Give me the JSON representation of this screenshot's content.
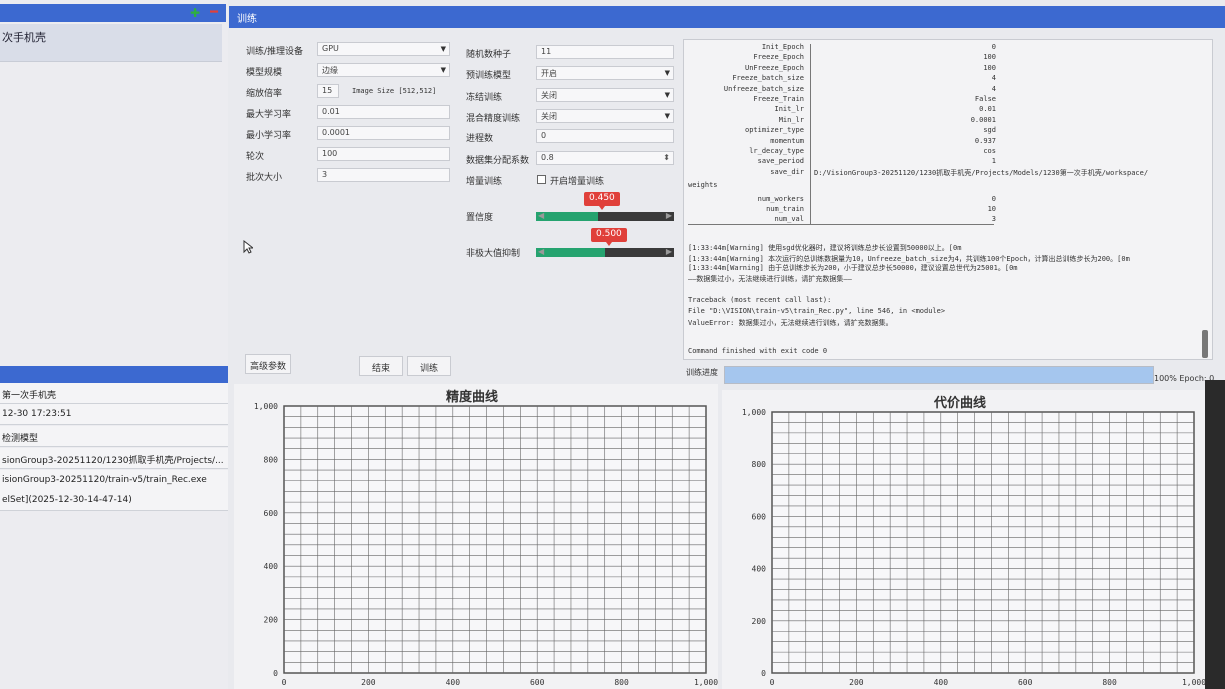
{
  "left_panel": {
    "tree_item": "次手机壳",
    "info_rows": [
      "第一次手机壳",
      "12-30 17:23:51",
      "检测模型",
      "sionGroup3-20251120/1230抓取手机壳/Projects/...",
      "isionGroup3-20251120/train-v5/train_Rec.exe",
      "elSet](2025-12-30-14-47-14)"
    ]
  },
  "header": {
    "title": "训练"
  },
  "form": {
    "col1": [
      {
        "label": "训练/推理设备",
        "value": "GPU",
        "type": "combo"
      },
      {
        "label": "模型规模",
        "value": "边缘",
        "type": "combo"
      },
      {
        "label": "缩放倍率",
        "value": "15",
        "extra": "Image Size [512,512]",
        "type": "text"
      },
      {
        "label": "最大学习率",
        "value": "0.01",
        "type": "text"
      },
      {
        "label": "最小学习率",
        "value": "0.0001",
        "type": "text"
      },
      {
        "label": "轮次",
        "value": "100",
        "type": "text"
      },
      {
        "label": "批次大小",
        "value": "3",
        "type": "text"
      }
    ],
    "col2": [
      {
        "label": "随机数种子",
        "value": "11",
        "type": "text"
      },
      {
        "label": "预训练模型",
        "value": "开启",
        "type": "combo"
      },
      {
        "label": "冻结训练",
        "value": "关闭",
        "type": "combo"
      },
      {
        "label": "混合精度训练",
        "value": "关闭",
        "type": "combo"
      },
      {
        "label": "进程数",
        "value": "0",
        "type": "text"
      },
      {
        "label": "数据集分配系数",
        "value": "0.8",
        "type": "spin"
      },
      {
        "label": "增量训练",
        "value": "开启增量训练",
        "type": "checkbox"
      }
    ],
    "sliders": [
      {
        "label": "置信度",
        "value": "0.450",
        "fraction": 0.45
      },
      {
        "label": "非极大值抑制",
        "value": "0.500",
        "fraction": 0.5
      }
    ]
  },
  "buttons": {
    "advanced": "高级参数",
    "end": "结束",
    "train": "训练"
  },
  "log": {
    "params": [
      {
        "k": "Init_Epoch",
        "v": "0"
      },
      {
        "k": "Freeze_Epoch",
        "v": "100"
      },
      {
        "k": "UnFreeze_Epoch",
        "v": "100"
      },
      {
        "k": "Freeze_batch_size",
        "v": "4"
      },
      {
        "k": "Unfreeze_batch_size",
        "v": "4"
      },
      {
        "k": "Freeze_Train",
        "v": "False"
      },
      {
        "k": "Init_lr",
        "v": "0.01"
      },
      {
        "k": "Min_lr",
        "v": "0.0001"
      },
      {
        "k": "optimizer_type",
        "v": "sgd"
      },
      {
        "k": "momentum",
        "v": "0.937"
      },
      {
        "k": "lr_decay_type",
        "v": "cos"
      },
      {
        "k": "save_period",
        "v": "1"
      },
      {
        "k": "save_dir",
        "v": "D:/VisionGroup3-20251120/1230抓取手机壳/Projects/Models/1230第一次手机壳/workspace/"
      },
      {
        "k": "weights",
        "v": ""
      },
      {
        "k": "num_workers",
        "v": "0"
      },
      {
        "k": "num_train",
        "v": "10"
      },
      {
        "k": "num_val",
        "v": "3"
      }
    ],
    "lines": [
      "[1:33:44m[Warning] 使用sgd优化器时，建议将训练总步长设置到50000以上。[0m",
      "[1:33:44m[Warning] 本次运行的总训练数据量为10，Unfreeze_batch_size为4，共训练100个Epoch，计算出总训练步长为200。[0m",
      "[1:33:44m[Warning] 由于总训练步长为200，小于建议总步长50000，建议设置总世代为25001。[0m",
      "——数据集过小，无法继续进行训练，请扩充数据集——",
      "",
      "Traceback (most recent call last):",
      "  File \"D:\\VISION\\train-v5\\train_Rec.py\", line 546, in <module>",
      "ValueError: 数据集过小，无法继续进行训练，请扩充数据集。",
      "",
      "Command finished with exit code 0"
    ]
  },
  "progress": {
    "label": "训练进度",
    "value": 1.0,
    "text": "100% Epoch: 0"
  },
  "chart_data": [
    {
      "type": "line",
      "title": "精度曲线",
      "xlim": [
        0,
        1000
      ],
      "ylim": [
        0,
        1000
      ],
      "xticks": [
        "0",
        "200",
        "400",
        "600",
        "800",
        "1,000"
      ],
      "yticks": [
        "0",
        "200",
        "400",
        "600",
        "800",
        "1,000"
      ],
      "series": []
    },
    {
      "type": "line",
      "title": "代价曲线",
      "xlim": [
        0,
        1000
      ],
      "ylim": [
        0,
        1000
      ],
      "xticks": [
        "0",
        "200",
        "400",
        "600",
        "800",
        "1,000"
      ],
      "yticks": [
        "0",
        "200",
        "400",
        "600",
        "800",
        "1,000"
      ],
      "series": []
    }
  ],
  "colors": {
    "accent": "#3c69d0",
    "slider": "#25a36f",
    "badge": "#e0403a",
    "progress": "#a5c6ee"
  }
}
